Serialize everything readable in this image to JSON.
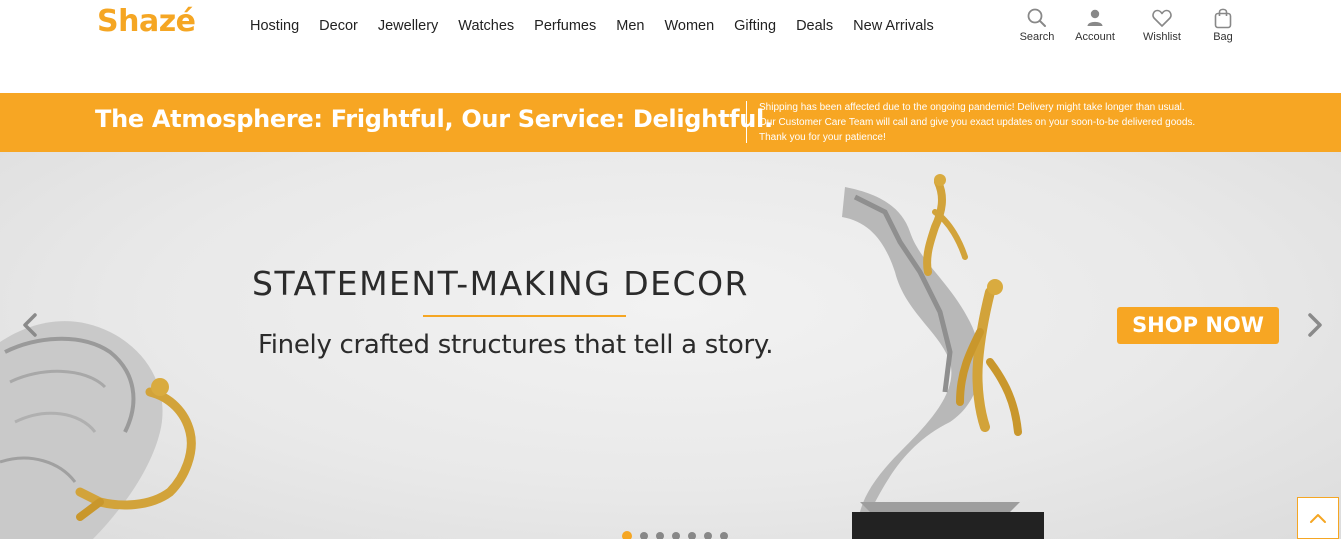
{
  "header": {
    "logo": "Shazé",
    "nav": [
      "Hosting",
      "Decor",
      "Jewellery",
      "Watches",
      "Perfumes",
      "Men",
      "Women",
      "Gifting",
      "Deals",
      "New Arrivals"
    ],
    "actions": [
      {
        "label": "Search",
        "icon": "search-icon"
      },
      {
        "label": "Account",
        "icon": "user-icon"
      },
      {
        "label": "Wishlist",
        "icon": "heart-icon"
      },
      {
        "label": "Bag",
        "icon": "bag-icon"
      }
    ]
  },
  "banner": {
    "headline": "The Atmosphere: Frightful, Our Service: Delightful.",
    "notice": [
      "Shipping has been affected due to the ongoing pandemic! Delivery might take longer than usual.",
      "Our Customer Care Team will call and give you exact updates on your soon-to-be delivered goods.",
      "Thank you for your patience!"
    ]
  },
  "hero": {
    "title": "STATEMENT-MAKING DECOR",
    "subtitle": "Finely crafted structures that tell a story.",
    "cta": "SHOP NOW",
    "slide_count": 7,
    "active_slide": 1
  },
  "colors": {
    "brand": "#f5a623",
    "banner": "#f7a623",
    "text": "#222222"
  }
}
